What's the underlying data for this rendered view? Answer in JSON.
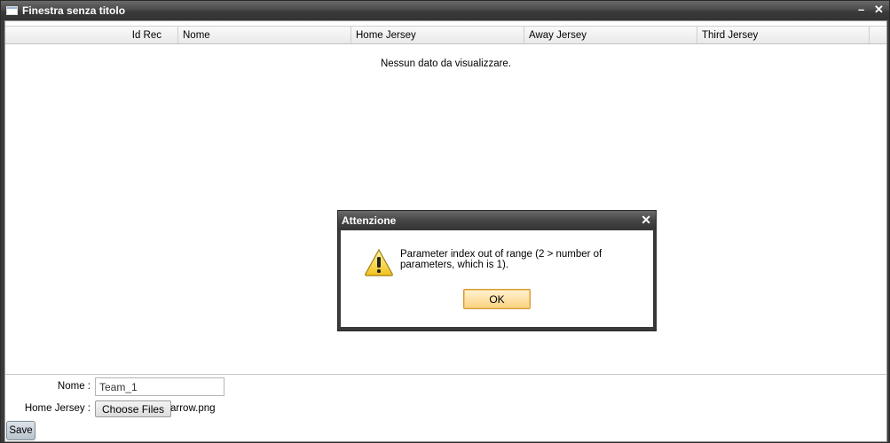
{
  "window": {
    "title": "Finestra senza titolo",
    "minimize": "–",
    "close": "✕"
  },
  "grid": {
    "columns": [
      "Id Rec",
      "Nome",
      "Home Jersey",
      "Away Jersey",
      "Third Jersey"
    ],
    "empty_message": "Nessun dato da visualizzare."
  },
  "form": {
    "nome_label": "Nome :",
    "nome_value": "Team_1",
    "home_jersey_label": "Home Jersey :",
    "choose_files_label": "Choose Files",
    "file_name": "arrow.png",
    "save_label": "Save"
  },
  "dialog": {
    "title": "Attenzione",
    "close": "✕",
    "message": "Parameter index out of range (2 > number of parameters, which is 1).",
    "ok_label": "OK",
    "icon": "warning-icon"
  }
}
